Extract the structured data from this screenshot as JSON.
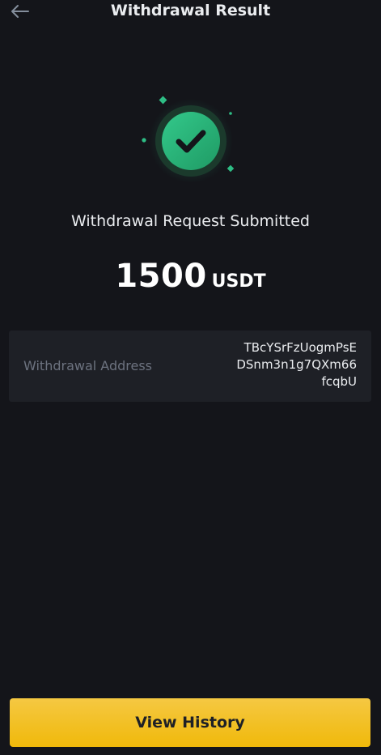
{
  "header": {
    "title": "Withdrawal Result"
  },
  "status": {
    "message": "Withdrawal Request Submitted"
  },
  "amount": {
    "value": "1500",
    "unit": "USDT"
  },
  "address": {
    "label": "Withdrawal Address",
    "lines": [
      "TBcYSrFzUogmPsE",
      "DSnm3n1g7QXm66",
      "fcqbU"
    ]
  },
  "actions": {
    "view_history_label": "View History"
  },
  "icons": {
    "back": "arrow-left-icon",
    "success": "check-circle-icon"
  },
  "colors": {
    "background": "#14151a",
    "card": "#1e2026",
    "accent": "#f0b90b",
    "success": "#2ebd85"
  }
}
